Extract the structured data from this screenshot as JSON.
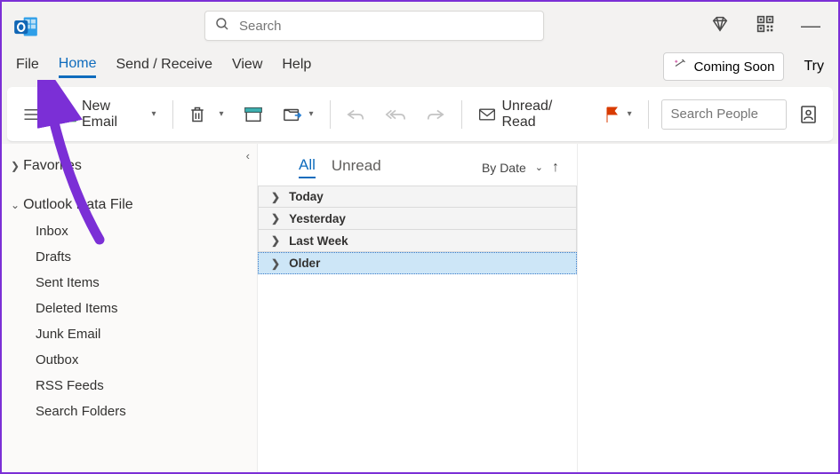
{
  "search": {
    "placeholder": "Search"
  },
  "menu": {
    "items": [
      "File",
      "Home",
      "Send / Receive",
      "View",
      "Help"
    ],
    "coming_soon": "Coming Soon",
    "try": "Try"
  },
  "ribbon": {
    "new_email": "New Email",
    "unread_read": "Unread/ Read",
    "people_placeholder": "Search People"
  },
  "sidebar": {
    "favorites": "Favorites",
    "data_file": "Outlook Data File",
    "folders": [
      "Inbox",
      "Drafts",
      "Sent Items",
      "Deleted Items",
      "Junk Email",
      "Outbox",
      "RSS Feeds",
      "Search Folders"
    ]
  },
  "mail": {
    "tabs": {
      "all": "All",
      "unread": "Unread"
    },
    "sort_label": "By Date",
    "groups": [
      "Today",
      "Yesterday",
      "Last Week",
      "Older"
    ]
  }
}
